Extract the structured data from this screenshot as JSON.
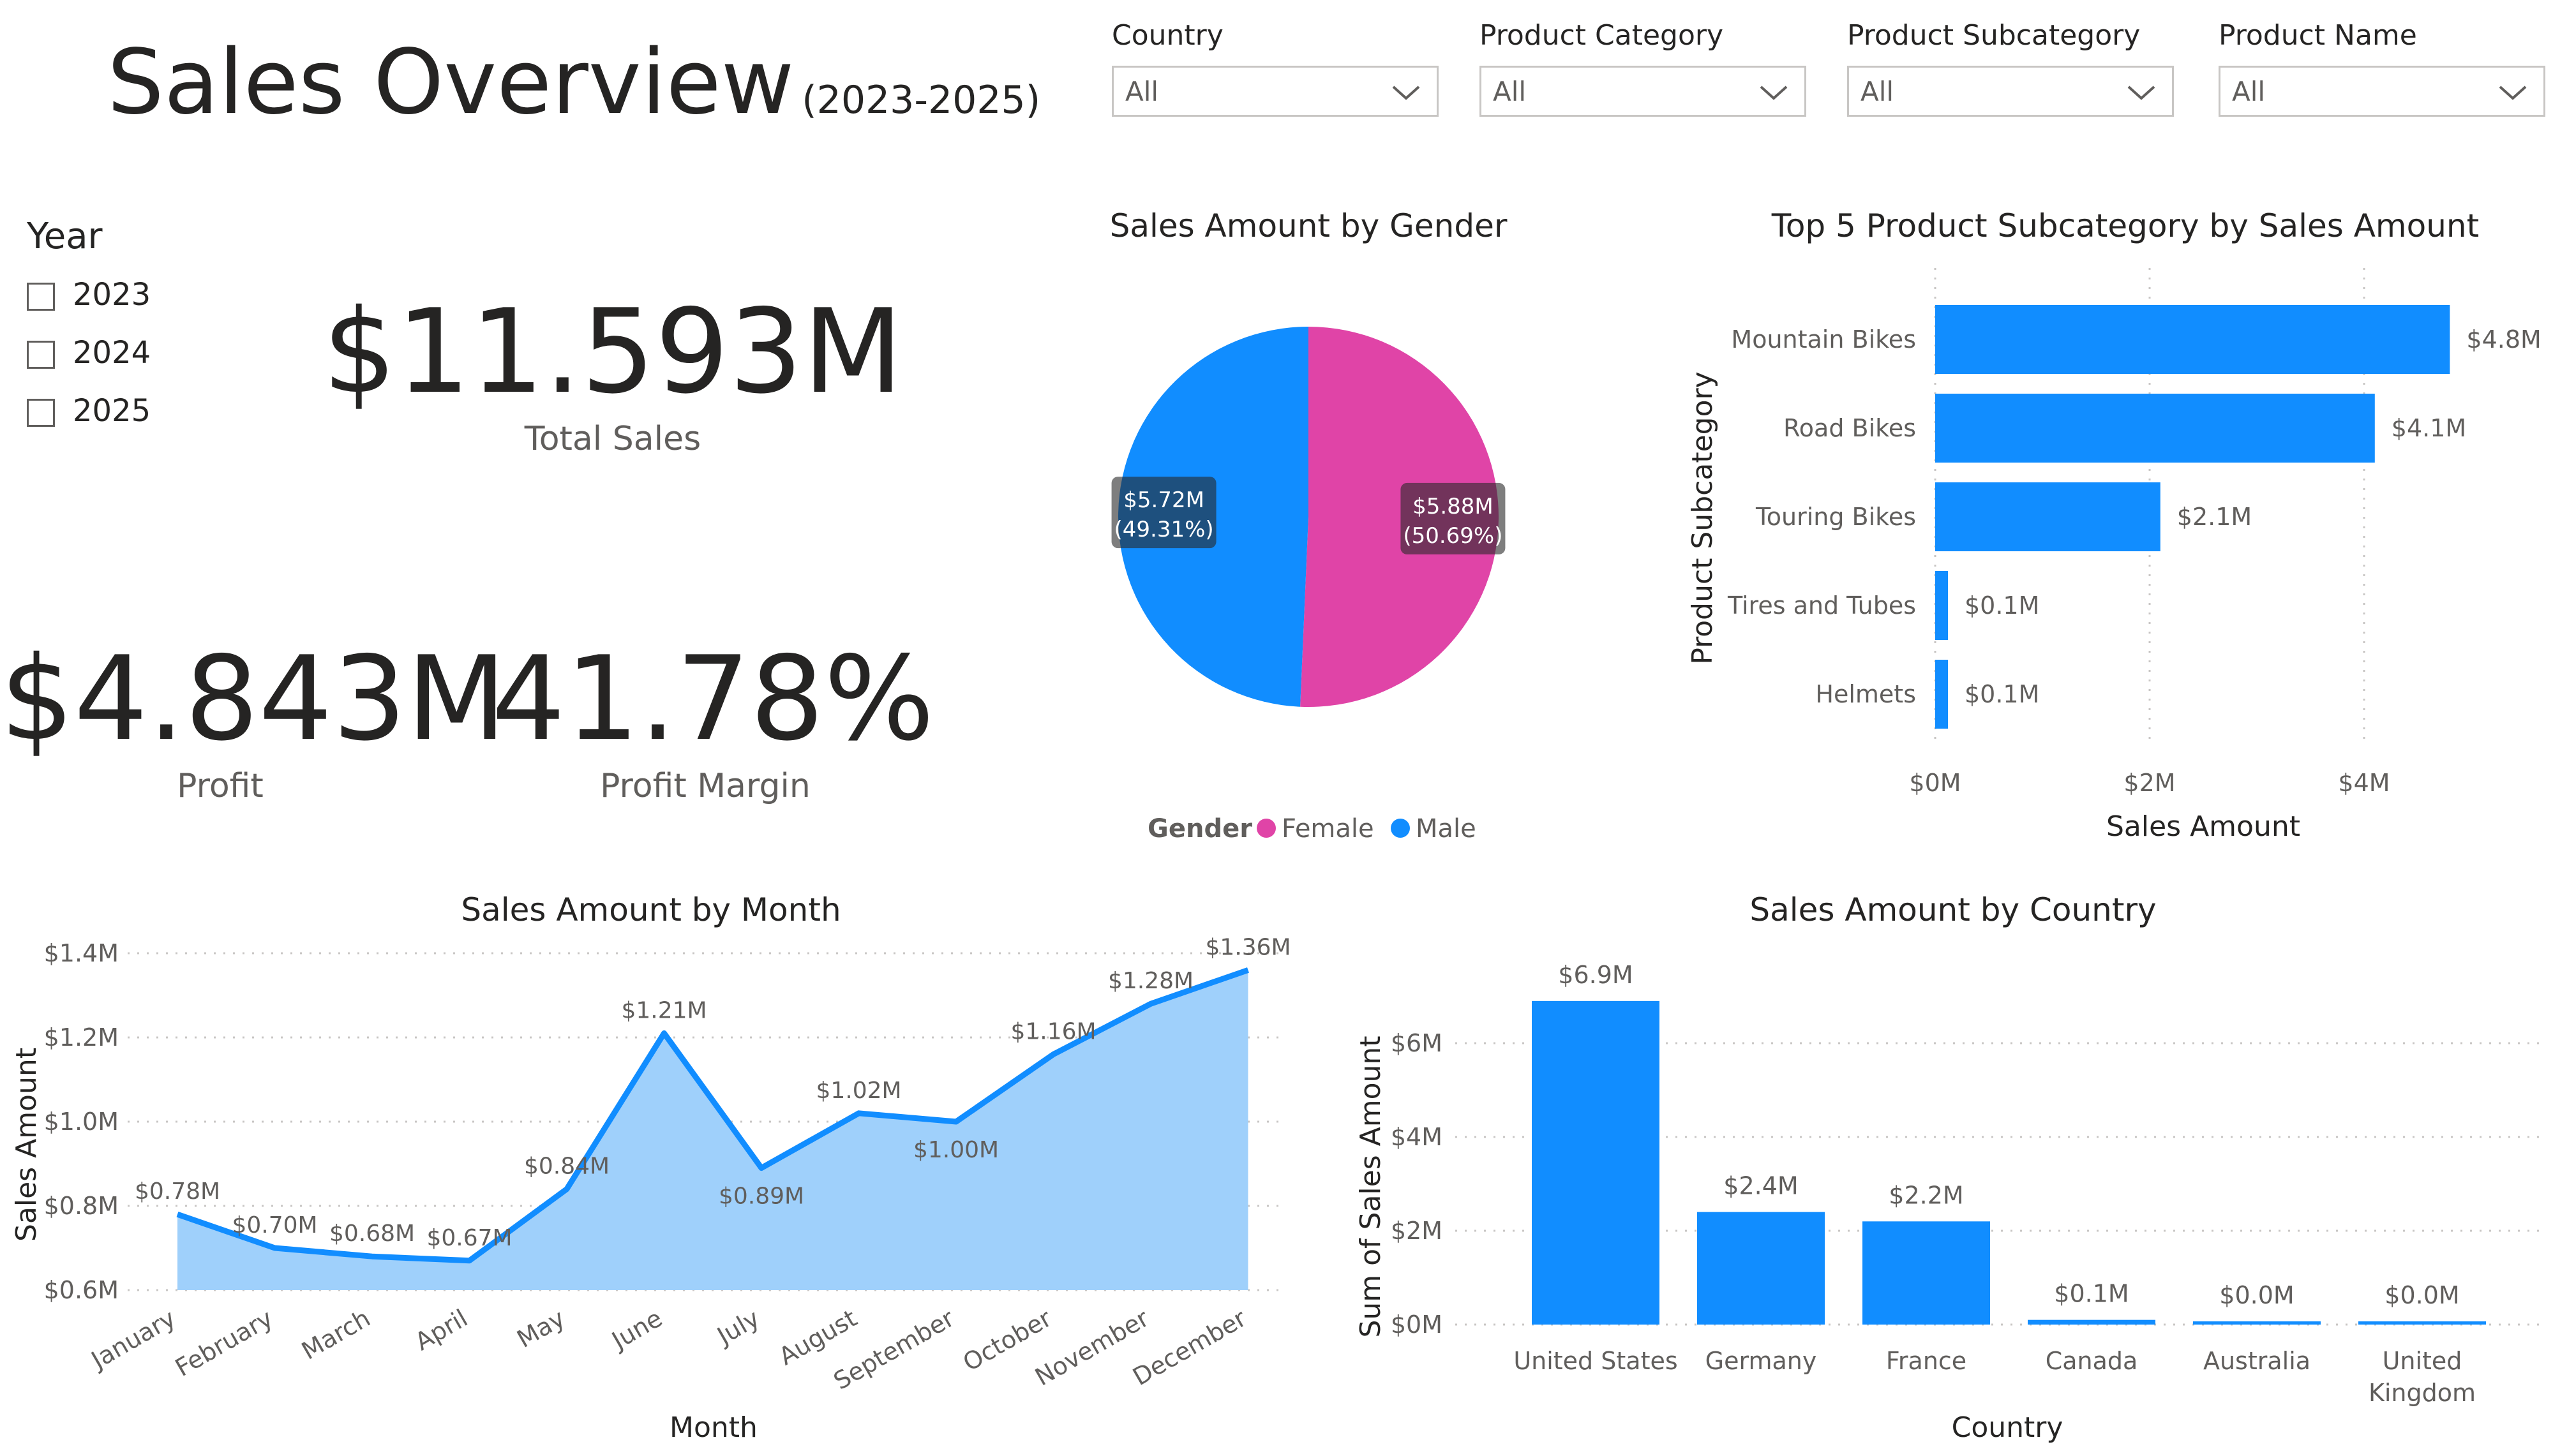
{
  "header": {
    "title": "Sales Overview",
    "subtitle": "(2023-2025)"
  },
  "filters": [
    {
      "label": "Country",
      "value": "All"
    },
    {
      "label": "Product Category",
      "value": "All"
    },
    {
      "label": "Product Subcategory",
      "value": "All"
    },
    {
      "label": "Product Name",
      "value": "All"
    }
  ],
  "year_slicer": {
    "title": "Year",
    "options": [
      "2023",
      "2024",
      "2025"
    ]
  },
  "kpis": {
    "total_sales": {
      "value": "$11.593M",
      "label": "Total Sales"
    },
    "profit": {
      "value": "$4.843M",
      "label": "Profit"
    },
    "profit_margin": {
      "value": "41.78%",
      "label": "Profit Margin"
    }
  },
  "colors": {
    "blue": "#118dff",
    "pink": "#e044a7",
    "area_fill": "#9fd0fb",
    "text": "#252423",
    "muted": "#605e5c"
  },
  "chart_data": [
    {
      "type": "pie",
      "title": "Sales Amount by Gender",
      "legend_title": "Gender",
      "legend_position": "bottom",
      "slices": [
        {
          "name": "Female",
          "value": 5.88,
          "label": "$5.88M",
          "percent_label": "(50.69%)",
          "percent": 50.69,
          "color": "#e044a7"
        },
        {
          "name": "Male",
          "value": 5.72,
          "label": "$5.72M",
          "percent_label": "(49.31%)",
          "percent": 49.31,
          "color": "#118dff"
        }
      ]
    },
    {
      "type": "bar",
      "orientation": "horizontal",
      "title": "Top 5 Product Subcategory by Sales Amount",
      "xlabel": "Sales Amount",
      "ylabel": "Product Subcategory",
      "categories": [
        "Mountain Bikes",
        "Road Bikes",
        "Touring Bikes",
        "Tires and Tubes",
        "Helmets"
      ],
      "values": [
        4.8,
        4.1,
        2.1,
        0.1,
        0.1
      ],
      "data_labels": [
        "$4.8M",
        "$4.1M",
        "$2.1M",
        "$0.1M",
        "$0.1M"
      ],
      "xticks": [
        "$0M",
        "$2M",
        "$4M"
      ],
      "xlim": [
        0,
        5.2
      ],
      "grid": true
    },
    {
      "type": "area",
      "title": "Sales Amount by Month",
      "xlabel": "Month",
      "ylabel": "Sales Amount",
      "categories": [
        "January",
        "February",
        "March",
        "April",
        "May",
        "June",
        "July",
        "August",
        "September",
        "October",
        "November",
        "December"
      ],
      "values": [
        0.78,
        0.7,
        0.68,
        0.67,
        0.84,
        1.21,
        0.89,
        1.02,
        1.0,
        1.16,
        1.28,
        1.36
      ],
      "data_labels": [
        "$0.78M",
        "$0.70M",
        "$0.68M",
        "$0.67M",
        "$0.84M",
        "$1.21M",
        "$0.89M",
        "$1.02M",
        "$1.00M",
        "$1.16M",
        "$1.28M",
        "$1.36M"
      ],
      "yticks": [
        "$0.6M",
        "$0.8M",
        "$1.0M",
        "$1.2M",
        "$1.4M"
      ],
      "ylim": [
        0.6,
        1.4
      ],
      "grid": true
    },
    {
      "type": "bar",
      "orientation": "vertical",
      "title": "Sales Amount by Country",
      "xlabel": "Country",
      "ylabel": "Sum of Sales Amount",
      "categories": [
        "United States",
        "Germany",
        "France",
        "Canada",
        "Australia",
        "United Kingdom"
      ],
      "category_lines": [
        [
          "United States"
        ],
        [
          "Germany"
        ],
        [
          "France"
        ],
        [
          "Canada"
        ],
        [
          "Australia"
        ],
        [
          "United",
          "Kingdom"
        ]
      ],
      "values": [
        6.9,
        2.4,
        2.2,
        0.1,
        0.0,
        0.0
      ],
      "data_labels": [
        "$6.9M",
        "$2.4M",
        "$2.2M",
        "$0.1M",
        "$0.0M",
        "$0.0M"
      ],
      "yticks": [
        "$0M",
        "$2M",
        "$4M",
        "$6M"
      ],
      "ylim": [
        0,
        7.5
      ],
      "grid": true
    }
  ]
}
